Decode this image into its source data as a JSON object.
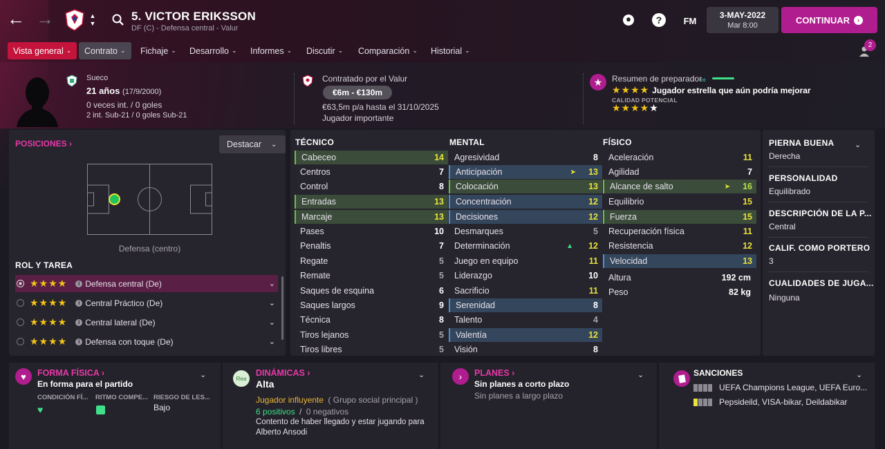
{
  "header": {
    "player_name": "5. VICTOR ERIKSSON",
    "subtitle": "DF (C) - Defensa central - Valur",
    "date": "3-MAY-2022",
    "time": "Mar 8:00",
    "continue_label": "CONTINUAR",
    "fm_label": "FM",
    "notification_count": "2"
  },
  "tabs": [
    {
      "label": "Vista general"
    },
    {
      "label": "Contrato"
    },
    {
      "label": "Fichaje"
    },
    {
      "label": "Desarrollo"
    },
    {
      "label": "Informes"
    },
    {
      "label": "Discutir"
    },
    {
      "label": "Comparación"
    },
    {
      "label": "Historial"
    }
  ],
  "profile": {
    "nationality": "Sueco",
    "age": "21 años",
    "dob": "(17/9/2000)",
    "caps": "0 veces int. / 0 goles",
    "u21": "2 int. Sub-21 / 0 goles Sub-21"
  },
  "contract": {
    "contracted_by": "Contratado por el Valur",
    "value_range": "€6m - €130m",
    "wage": "€63,5m p/a hasta el 31/10/2025",
    "status": "Jugador importante"
  },
  "coach": {
    "title": "Resumen de preparador",
    "summary": "Jugador estrella que aún podría mejorar",
    "potential_label": "CALIDAD POTENCIAL",
    "current_stars": "★★★★",
    "potential_stars": "★★★★★"
  },
  "positions": {
    "title": "POSICIONES",
    "highlight_label": "Destacar",
    "position_name": "Defensa (centro)"
  },
  "roles": {
    "title": "ROL Y TAREA",
    "items": [
      {
        "name": "Defensa central (De)",
        "stars": "★★★★"
      },
      {
        "name": "Central Práctico (De)",
        "stars": "★★★★"
      },
      {
        "name": "Central lateral (De)",
        "stars": "★★★★"
      },
      {
        "name": "Defensa con toque (De)",
        "stars": "★★★★"
      }
    ]
  },
  "technical": {
    "title": "TÉCNICO",
    "items": [
      {
        "name": "Cabeceo",
        "value": "14"
      },
      {
        "name": "Centros",
        "value": "7"
      },
      {
        "name": "Control",
        "value": "8"
      },
      {
        "name": "Entradas",
        "value": "13"
      },
      {
        "name": "Marcaje",
        "value": "13"
      },
      {
        "name": "Pases",
        "value": "10"
      },
      {
        "name": "Penaltis",
        "value": "7"
      },
      {
        "name": "Regate",
        "value": "5"
      },
      {
        "name": "Remate",
        "value": "5"
      },
      {
        "name": "Saques de esquina",
        "value": "6"
      },
      {
        "name": "Saques largos",
        "value": "9"
      },
      {
        "name": "Técnica",
        "value": "8"
      },
      {
        "name": "Tiros lejanos",
        "value": "5"
      },
      {
        "name": "Tiros libres",
        "value": "5"
      }
    ]
  },
  "mental": {
    "title": "MENTAL",
    "items": [
      {
        "name": "Agresividad",
        "value": "8"
      },
      {
        "name": "Anticipación",
        "value": "13"
      },
      {
        "name": "Colocación",
        "value": "13"
      },
      {
        "name": "Concentración",
        "value": "12"
      },
      {
        "name": "Decisiones",
        "value": "12"
      },
      {
        "name": "Desmarques",
        "value": "5"
      },
      {
        "name": "Determinación",
        "value": "12"
      },
      {
        "name": "Juego en equipo",
        "value": "11"
      },
      {
        "name": "Liderazgo",
        "value": "10"
      },
      {
        "name": "Sacrificio",
        "value": "11"
      },
      {
        "name": "Serenidad",
        "value": "8"
      },
      {
        "name": "Talento",
        "value": "4"
      },
      {
        "name": "Valentía",
        "value": "12"
      },
      {
        "name": "Visión",
        "value": "8"
      }
    ]
  },
  "physical": {
    "title": "FÍSICO",
    "items": [
      {
        "name": "Aceleración",
        "value": "11"
      },
      {
        "name": "Agilidad",
        "value": "7"
      },
      {
        "name": "Alcance de salto",
        "value": "16"
      },
      {
        "name": "Equilibrio",
        "value": "15"
      },
      {
        "name": "Fuerza",
        "value": "15"
      },
      {
        "name": "Recuperación física",
        "value": "11"
      },
      {
        "name": "Resistencia",
        "value": "12"
      },
      {
        "name": "Velocidad",
        "value": "13"
      }
    ],
    "height_label": "Altura",
    "height": "192 cm",
    "weight_label": "Peso",
    "weight": "82 kg"
  },
  "side": {
    "foot_title": "PIERNA BUENA",
    "foot": "Derecha",
    "personality_title": "PERSONALIDAD",
    "personality": "Equilibrado",
    "media_title": "DESCRIPCIÓN DE LA P...",
    "media": "Central",
    "gk_title": "CALIF. COMO PORTERO",
    "gk": "3",
    "qualities_title": "CUALIDADES DE JUGA...",
    "qualities": "Ninguna"
  },
  "fitness": {
    "title": "FORMA FÍSICA",
    "status": "En forma para el partido",
    "col1": "CONDICIÓN FÍ...",
    "col2": "RITMO COMPE...",
    "col3": "RIESGO DE LES...",
    "risk": "Bajo"
  },
  "dynamics": {
    "title": "DINÁMICAS",
    "badge": "Rea",
    "level": "Alta",
    "influence": "Jugador influyente",
    "group": "( Grupo social principal )",
    "positives": "6 positivos",
    "separator": "/",
    "negatives": "0 negativos",
    "note": "Contento de haber llegado y estar jugando para Alberto Ansodi"
  },
  "plans": {
    "title": "PLANES",
    "short": "Sin planes a corto plazo",
    "long": "Sin planes a largo plazo"
  },
  "sanctions": {
    "title": "SANCIONES",
    "line1": "UEFA Champions League, UEFA Euro...",
    "line2": "Pepsideild, VISA-bikar, Deildabikar"
  },
  "colors": {
    "accent": "#b01d8e",
    "active_tab": "#c4143c",
    "highlight_green": "#3b4d3a",
    "highlight_blue": "#34465c"
  }
}
